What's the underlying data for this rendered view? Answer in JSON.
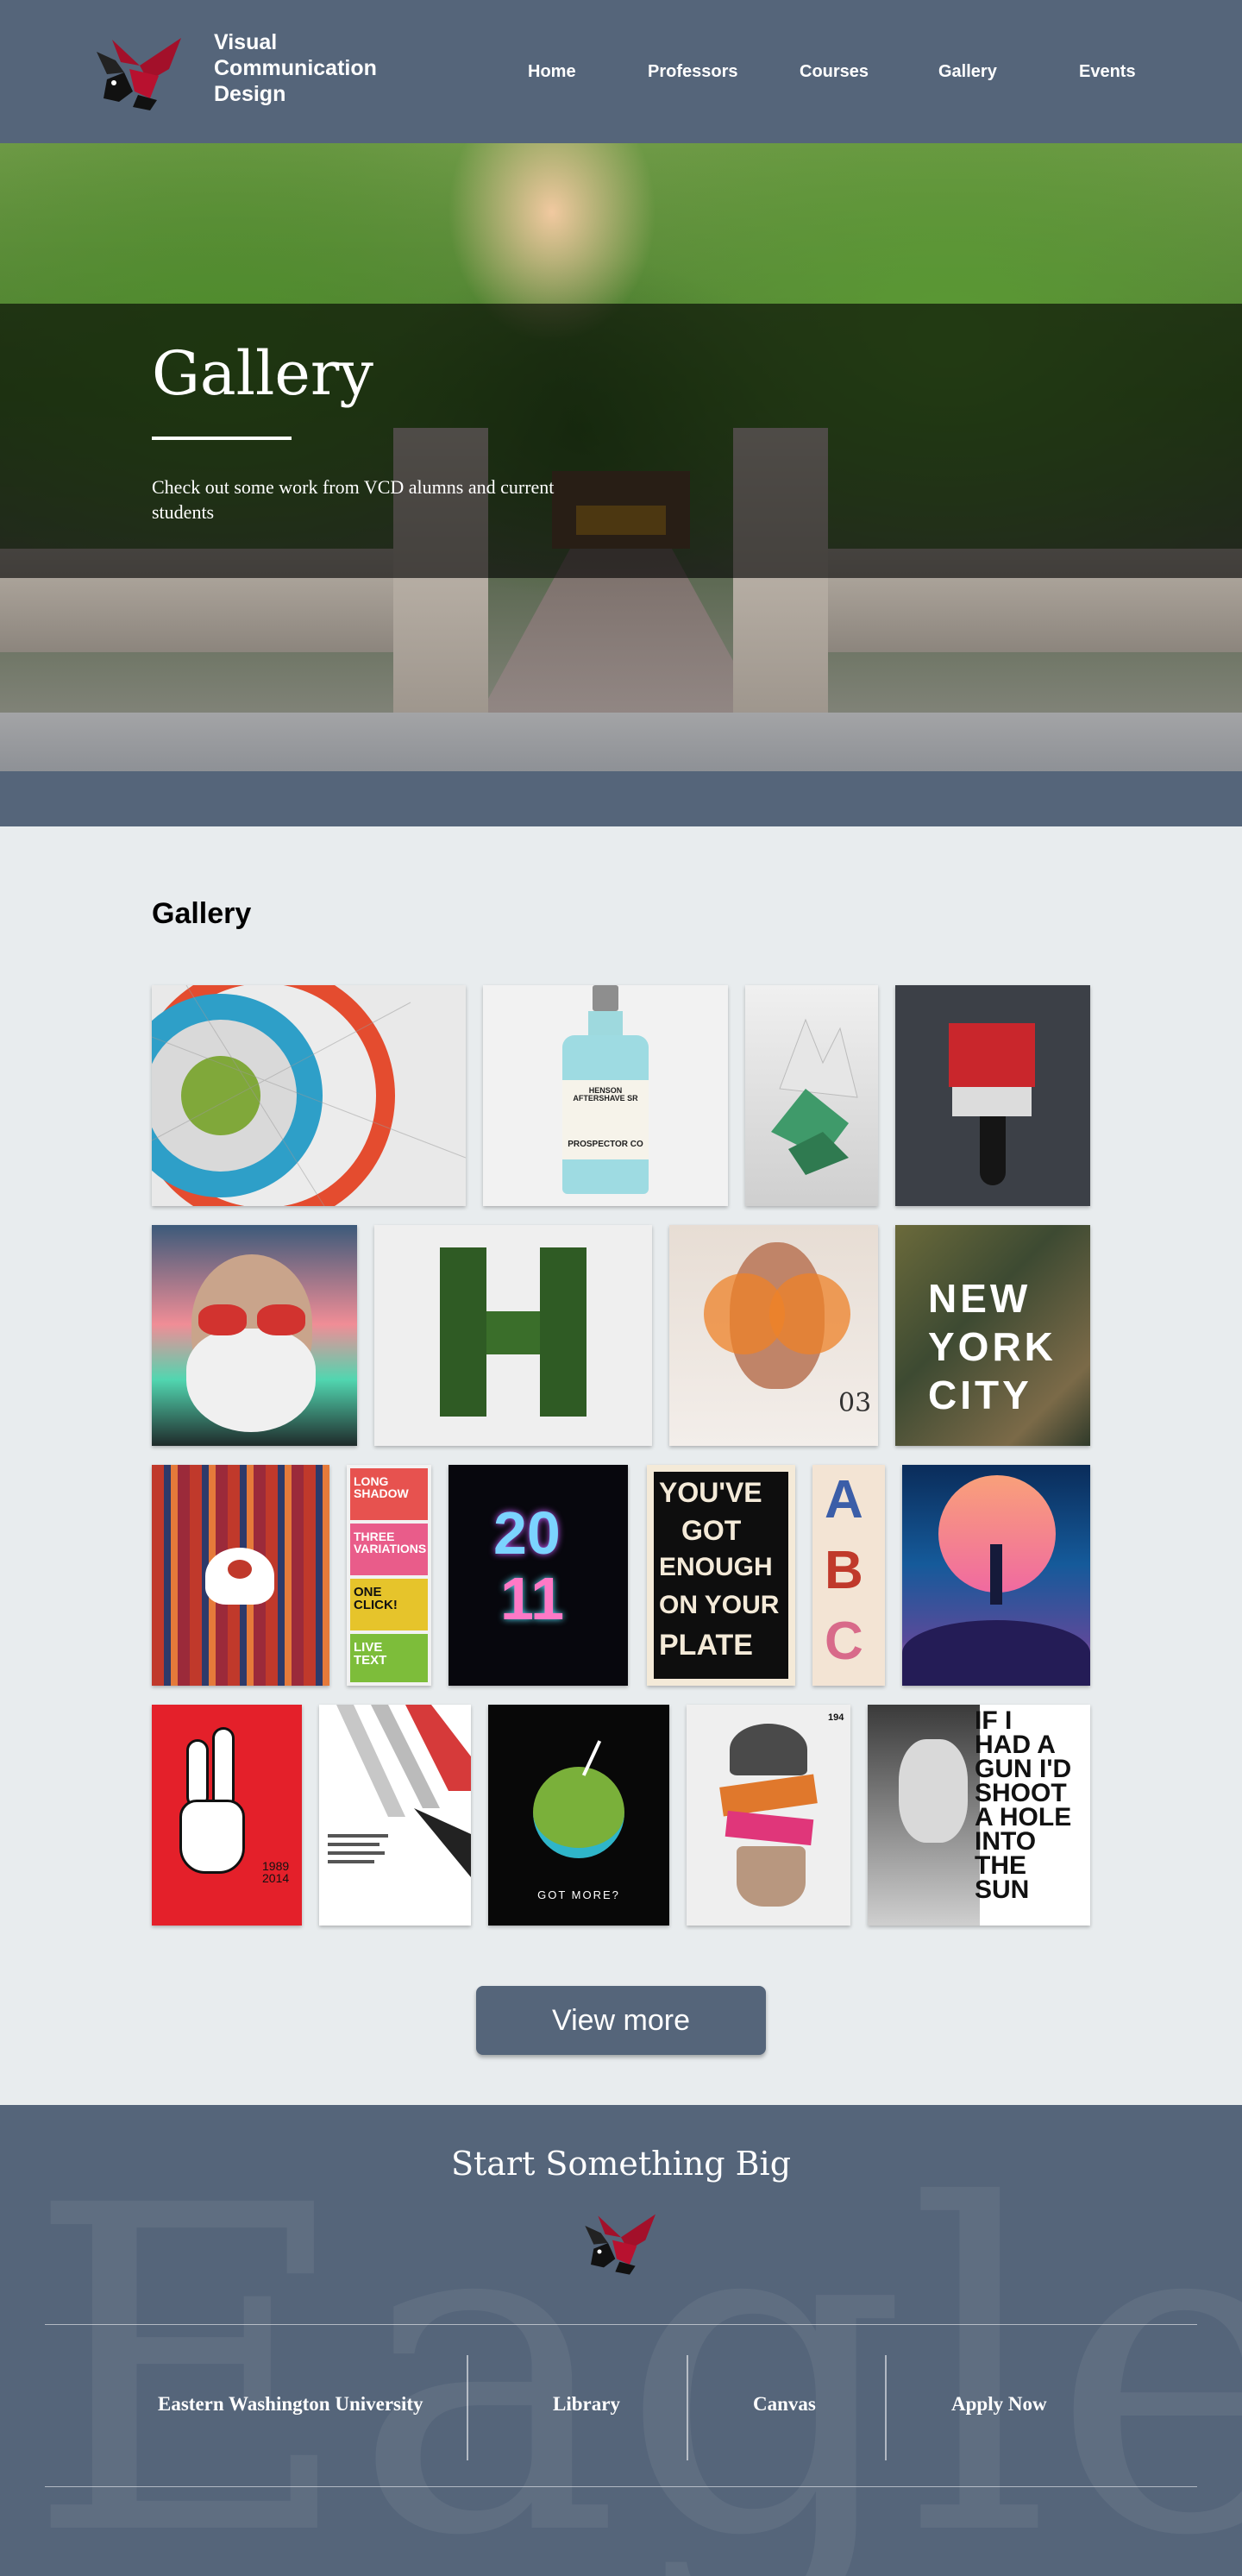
{
  "nav": {
    "logo_icon": "eagle-logo-icon",
    "site_name": [
      "Visual",
      "Communication",
      "Design"
    ],
    "links": [
      "Home",
      "Professors",
      "Courses",
      "Gallery",
      "Events"
    ]
  },
  "hero": {
    "title": "Gallery",
    "subtitle": "Check out some work from VCD alumns and current students"
  },
  "gallery": {
    "heading": "Gallery",
    "tile_text": {
      "bottle_label_1": "HENSON AFTERSHAVE SR",
      "bottle_label_2": "PROSPECTOR CO",
      "ny_1": "NEW",
      "ny_2": "YORK",
      "ny_3": "CITY",
      "number_03": "03",
      "long_shadow": "LONG SHADOW",
      "three_variations": "THREE VARIATIONS",
      "one_click": "ONE CLICK!",
      "live_text": "LIVE TEXT",
      "year_20": "20",
      "year_11": "11",
      "plate_1": "YOU'VE",
      "plate_2": "GOT",
      "plate_3": "ENOUGH",
      "plate_4": "ON YOUR",
      "plate_5": "PLATE",
      "letter_a": "A",
      "letter_b": "B",
      "letter_c": "C",
      "years": "1989 2014",
      "got_more": "GOT MORE?",
      "mag_num": "194",
      "song_1": "IF I",
      "song_2": "HAD A",
      "song_3": "GUN I'D",
      "song_4": "SHOOT",
      "song_5": "A HOLE",
      "song_6": "INTO",
      "song_7": "THE",
      "song_8": "SUN"
    },
    "view_more": "View more"
  },
  "footer": {
    "title": "Start Something Big",
    "watermark": "Eagles",
    "links": [
      "Eastern Washington University",
      "Library",
      "Canvas",
      "Apply Now"
    ]
  },
  "colors": {
    "nav_bg": "#55657a",
    "page_bg": "#e8ecee",
    "brand_red": "#a3102a"
  }
}
